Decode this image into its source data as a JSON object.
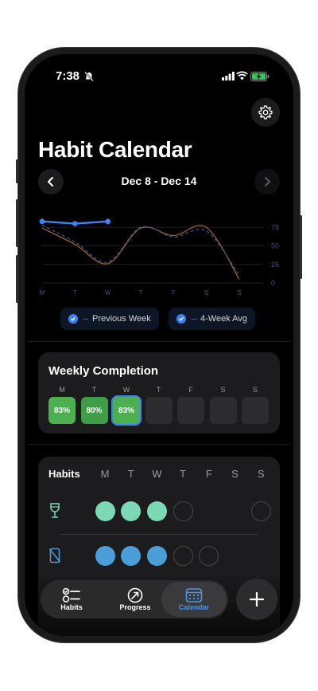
{
  "status_bar": {
    "time": "7:38"
  },
  "header": {
    "title": "Habit Calendar",
    "week_range": "Dec 8 - Dec 14"
  },
  "chart_data": {
    "type": "line",
    "categories": [
      "M",
      "T",
      "W",
      "T",
      "F",
      "S",
      "S"
    ],
    "y_ticks": [
      "75",
      "50",
      "25",
      "0"
    ],
    "ylim": [
      0,
      100
    ],
    "series": [
      {
        "name": "",
        "values": [
          83,
          80,
          83
        ],
        "style": "solid",
        "color": "#3b82f6"
      },
      {
        "name": "Previous Week",
        "values": [
          78,
          55,
          28,
          75,
          62,
          70,
          10
        ],
        "style": "dashed",
        "color": "#3d4f9a"
      },
      {
        "name": "4-Week Avg",
        "values": [
          74,
          52,
          26,
          74,
          64,
          75,
          5
        ],
        "style": "solid",
        "color": "#a0612a"
      }
    ],
    "grid": true,
    "legend": "bottom"
  },
  "legend": {
    "prev_week": "Previous Week",
    "avg": "4-Week Avg"
  },
  "weekly_completion": {
    "title": "Weekly Completion",
    "days": [
      "M",
      "T",
      "W",
      "T",
      "F",
      "S",
      "S"
    ],
    "values": [
      "83%",
      "80%",
      "83%",
      "",
      "",
      "",
      ""
    ]
  },
  "habits": {
    "header": "Habits",
    "days": [
      "M",
      "T",
      "W",
      "T",
      "F",
      "S",
      "S"
    ],
    "rows": [
      {
        "icon": "wine-glass-icon",
        "color": "#7dd9b5",
        "done": [
          true,
          true,
          true,
          false,
          null,
          null,
          false
        ]
      },
      {
        "icon": "phone-off-icon",
        "color": "#4a9fd8",
        "done": [
          true,
          true,
          true,
          false,
          false,
          null,
          null
        ]
      }
    ]
  },
  "tabs": [
    {
      "label": "Habits",
      "icon": "habits-list-icon"
    },
    {
      "label": "Progress",
      "icon": "progress-icon"
    },
    {
      "label": "Calendar",
      "icon": "calendar-icon"
    }
  ],
  "colors": {
    "accent": "#3b82f6",
    "completion_green": "#4caf50",
    "tab_active": "#4b95e9"
  }
}
